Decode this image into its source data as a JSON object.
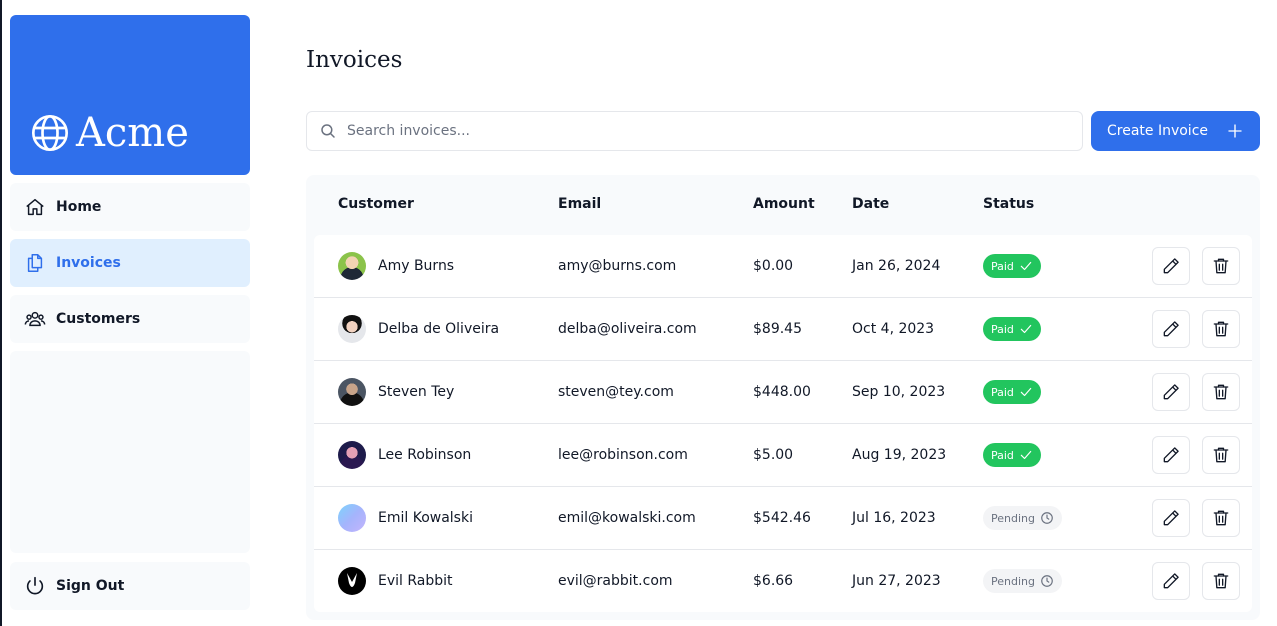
{
  "brand": {
    "name": "Acme",
    "color": "#2f6feb",
    "logo_icon": "globe-icon"
  },
  "sidebar": {
    "items": [
      {
        "label": "Home",
        "icon": "home-icon"
      },
      {
        "label": "Invoices",
        "icon": "document-duplicate-icon",
        "active": true
      },
      {
        "label": "Customers",
        "icon": "users-icon"
      }
    ],
    "sign_out": {
      "label": "Sign Out",
      "icon": "power-icon"
    }
  },
  "main": {
    "title": "Invoices",
    "search": {
      "placeholder": "Search invoices...",
      "value": ""
    },
    "create_button": "Create Invoice",
    "table": {
      "headers": {
        "customer": "Customer",
        "email": "Email",
        "amount": "Amount",
        "date": "Date",
        "status": "Status"
      },
      "rows": [
        {
          "name": "Amy Burns",
          "email": "amy@burns.com",
          "amount": "$0.00",
          "date": "Jan 26, 2024",
          "status": "Paid"
        },
        {
          "name": "Delba de Oliveira",
          "email": "delba@oliveira.com",
          "amount": "$89.45",
          "date": "Oct 4, 2023",
          "status": "Paid"
        },
        {
          "name": "Steven Tey",
          "email": "steven@tey.com",
          "amount": "$448.00",
          "date": "Sep 10, 2023",
          "status": "Paid"
        },
        {
          "name": "Lee Robinson",
          "email": "lee@robinson.com",
          "amount": "$5.00",
          "date": "Aug 19, 2023",
          "status": "Paid"
        },
        {
          "name": "Emil Kowalski",
          "email": "emil@kowalski.com",
          "amount": "$542.46",
          "date": "Jul 16, 2023",
          "status": "Pending"
        },
        {
          "name": "Evil Rabbit",
          "email": "evil@rabbit.com",
          "amount": "$6.66",
          "date": "Jun 27, 2023",
          "status": "Pending"
        }
      ]
    }
  },
  "colors": {
    "accent": "#2f6feb",
    "paid": "#22c55e",
    "pending_bg": "#f3f4f6",
    "active_nav_bg": "#e0effe"
  }
}
